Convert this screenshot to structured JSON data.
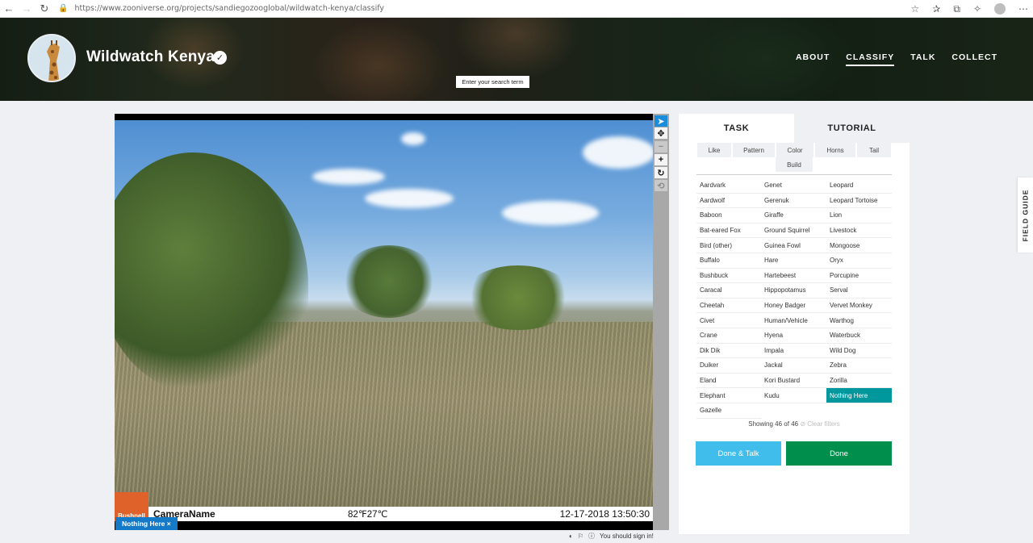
{
  "browser": {
    "url": "https://www.zooniverse.org/projects/sandiegozooglobal/wildwatch-kenya/classify",
    "icons": [
      "back-arrow-icon",
      "forward-arrow-icon",
      "reload-icon",
      "lock-icon",
      "read-aloud-icon",
      "favorites-icon",
      "collections-icon",
      "extensions-icon",
      "profile-icon",
      "more-icon"
    ]
  },
  "project": {
    "title": "Wildwatch Kenya",
    "search_tooltip": "Enter your search term",
    "nav": [
      {
        "label": "ABOUT",
        "active": false
      },
      {
        "label": "CLASSIFY",
        "active": true
      },
      {
        "label": "TALK",
        "active": false
      },
      {
        "label": "COLLECT",
        "active": false
      }
    ]
  },
  "camera": {
    "brand": "Bushnell",
    "name": "CameraName",
    "temperature": "82℉27℃",
    "datetime": "12-17-2018 13:50:30"
  },
  "viewer_tag": "Nothing Here ×",
  "sign_in_text": "You should sign in!",
  "panel": {
    "tabs": [
      "TASK",
      "TUTORIAL"
    ],
    "filter_row1": [
      "Like",
      "Pattern",
      "Color",
      "Horns",
      "Tail"
    ],
    "filter_row2": [
      "Build"
    ],
    "choices": [
      "Aardvark",
      "Genet",
      "Leopard",
      "Aardwolf",
      "Gerenuk",
      "Leopard Tortoise",
      "Baboon",
      "Giraffe",
      "Lion",
      "Bat-eared Fox",
      "Ground Squirrel",
      "Livestock",
      "Bird (other)",
      "Guinea Fowl",
      "Mongoose",
      "Buffalo",
      "Hare",
      "Oryx",
      "Bushbuck",
      "Hartebeest",
      "Porcupine",
      "Caracal",
      "Hippopotamus",
      "Serval",
      "Cheetah",
      "Honey Badger",
      "Vervet Monkey",
      "Civet",
      "Human/Vehicle",
      "Warthog",
      "Crane",
      "Hyena",
      "Waterbuck",
      "Dik Dik",
      "Impala",
      "Wild Dog",
      "Duiker",
      "Jackal",
      "Zebra",
      "Eland",
      "Kori Bustard",
      "Zorilla",
      "Elephant",
      "Kudu",
      "Nothing Here",
      "Gazelle"
    ],
    "selected_choice": "Nothing Here",
    "showing": "Showing 46 of 46",
    "clear_filters": "⊘ Clear filters",
    "done_talk_label": "Done & Talk",
    "done_label": "Done"
  },
  "field_guide_label": "FIELD GUIDE",
  "colors": {
    "accent_teal": "#00979d",
    "done_green": "#008e4c",
    "talk_blue": "#40bdea",
    "tag_blue": "#1479c6"
  }
}
